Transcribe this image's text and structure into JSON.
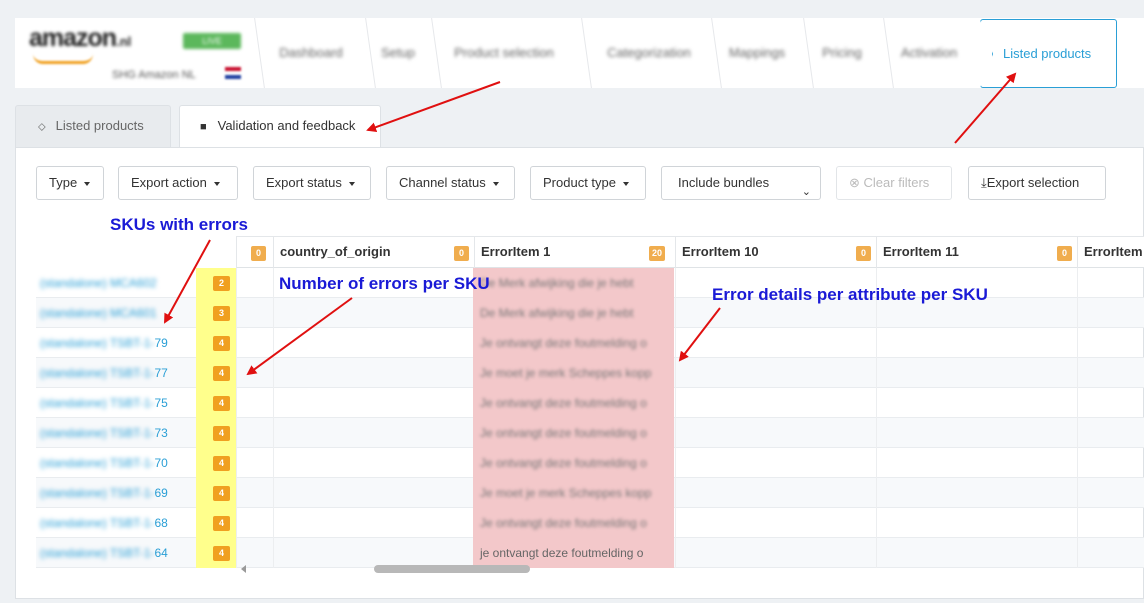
{
  "brand": {
    "logo_text": "amazon",
    "logo_tld": ".nl",
    "env_badge": "LIVE",
    "store_name": "SHG Amazon NL"
  },
  "wizard": {
    "steps": [
      "Dashboard",
      "Setup",
      "Product selection",
      "Categorization",
      "Mappings",
      "Pricing",
      "Activation"
    ],
    "active_step": "Listed products"
  },
  "tabs": {
    "listed": "Listed products",
    "validation": "Validation and feedback"
  },
  "filters": {
    "type": "Type",
    "export_action": "Export action",
    "export_status": "Export status",
    "channel_status": "Channel status",
    "product_type": "Product type",
    "bundles": "Include bundles",
    "clear": "Clear filters",
    "export_selection": "Export selection"
  },
  "grid": {
    "columns": [
      {
        "name": "",
        "count": "0"
      },
      {
        "name": "country_of_origin",
        "count": "0"
      },
      {
        "name": "ErrorItem 1",
        "count": "20"
      },
      {
        "name": "ErrorItem 10",
        "count": "0"
      },
      {
        "name": "ErrorItem 11",
        "count": "0"
      },
      {
        "name": "ErrorItem",
        "count": ""
      }
    ],
    "rows": [
      {
        "sku_prefix": "(standalone) MCA602",
        "sku_suffix": "",
        "errors": "2",
        "error_1": "De Merk afwijking die je hebt"
      },
      {
        "sku_prefix": "(standalone) MCA601",
        "sku_suffix": "",
        "errors": "3",
        "error_1": "De Merk afwijking die je hebt"
      },
      {
        "sku_prefix": "(standalone) TSBT-1-",
        "sku_suffix": "79",
        "errors": "4",
        "error_1": "Je ontvangt deze foutmelding o"
      },
      {
        "sku_prefix": "(standalone) TSBT-1-",
        "sku_suffix": "77",
        "errors": "4",
        "error_1": "Je moet je merk Scheppes kopp"
      },
      {
        "sku_prefix": "(standalone) TSBT-1-",
        "sku_suffix": "75",
        "errors": "4",
        "error_1": "Je ontvangt deze foutmelding o"
      },
      {
        "sku_prefix": "(standalone) TSBT-1-",
        "sku_suffix": "73",
        "errors": "4",
        "error_1": "Je ontvangt deze foutmelding o"
      },
      {
        "sku_prefix": "(standalone) TSBT-1-",
        "sku_suffix": "70",
        "errors": "4",
        "error_1": "Je ontvangt deze foutmelding o"
      },
      {
        "sku_prefix": "(standalone) TSBT-1-",
        "sku_suffix": "69",
        "errors": "4",
        "error_1": "Je moet je merk Scheppes kopp"
      },
      {
        "sku_prefix": "(standalone) TSBT-1-",
        "sku_suffix": "68",
        "errors": "4",
        "error_1": "Je ontvangt deze foutmelding o"
      },
      {
        "sku_prefix": "(standalone) TSBT-1-",
        "sku_suffix": "64",
        "errors": "4",
        "error_1": "je ontvangt deze foutmelding o"
      }
    ]
  },
  "annotations": {
    "skus": "SKUs with errors",
    "count": "Number of errors per SKU",
    "details": "Error details per attribute per SKU"
  },
  "colors": {
    "accent": "#2a9fd6",
    "badge": "#f0a020",
    "error_cell": "#f3c8ca",
    "count_highlight": "#ffff8c",
    "annotation": "#1a1ad6",
    "arrow": "#e01010"
  }
}
